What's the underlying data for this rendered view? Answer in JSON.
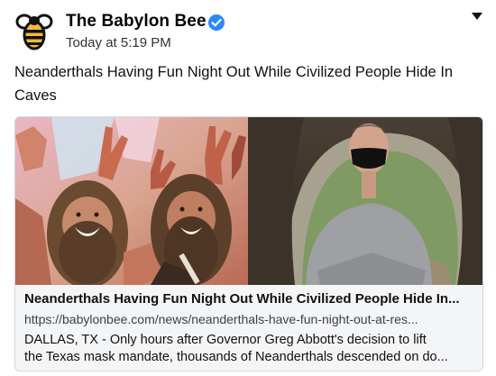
{
  "post": {
    "author": "The Babylon Bee",
    "timestamp": "Today at 5:19 PM",
    "text": "Neanderthals Having Fun Night Out While Civilized People Hide In Caves",
    "icons": {
      "logo": "bee-logo-icon",
      "verified": "verified-badge-icon",
      "menu": "caret-down-icon"
    }
  },
  "link_card": {
    "title": "Neanderthals Having Fun Night Out While Civilized People Hide In...",
    "url": "https://babylonbee.com/news/neanderthals-have-fun-night-out-at-res...",
    "description_lines": [
      "DALLAS, TX - Only hours after Governor Greg Abbott's decision to lift",
      "the Texas mask mandate, thousands of Neanderthals descended on do..."
    ]
  },
  "colors": {
    "verified_blue": "#2d88ff",
    "card_background": "#f4f5f7"
  }
}
